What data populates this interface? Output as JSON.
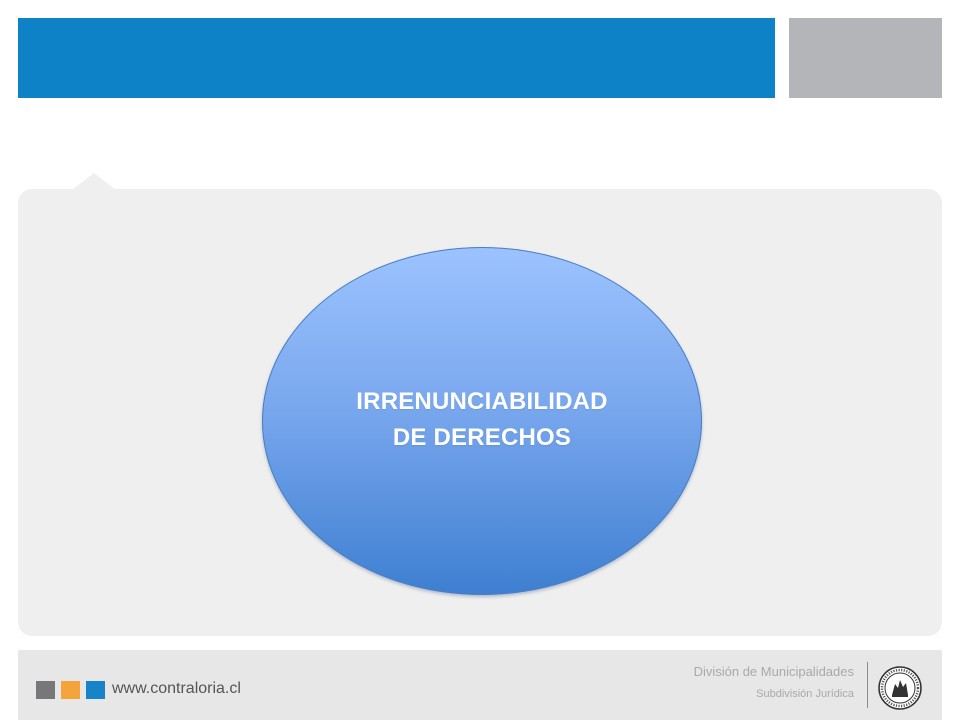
{
  "header": {
    "banner_color": "#0e82c6",
    "secondary_color": "#b4b5b8"
  },
  "main": {
    "ellipse_line_1": "IRRENUNCIABILIDAD",
    "ellipse_line_2": "DE DERECHOS",
    "ellipse_gradient_top": "#9cc3ff",
    "ellipse_gradient_bottom": "#3e7fd1"
  },
  "footer": {
    "url": "www.contraloria.cl",
    "division": "División de Municipalidades",
    "subdivision": "Subdivisión Jurídica",
    "squares": [
      "#77777a",
      "#f5a33b",
      "#1783c8"
    ],
    "seal_icon": "seal-icon"
  }
}
